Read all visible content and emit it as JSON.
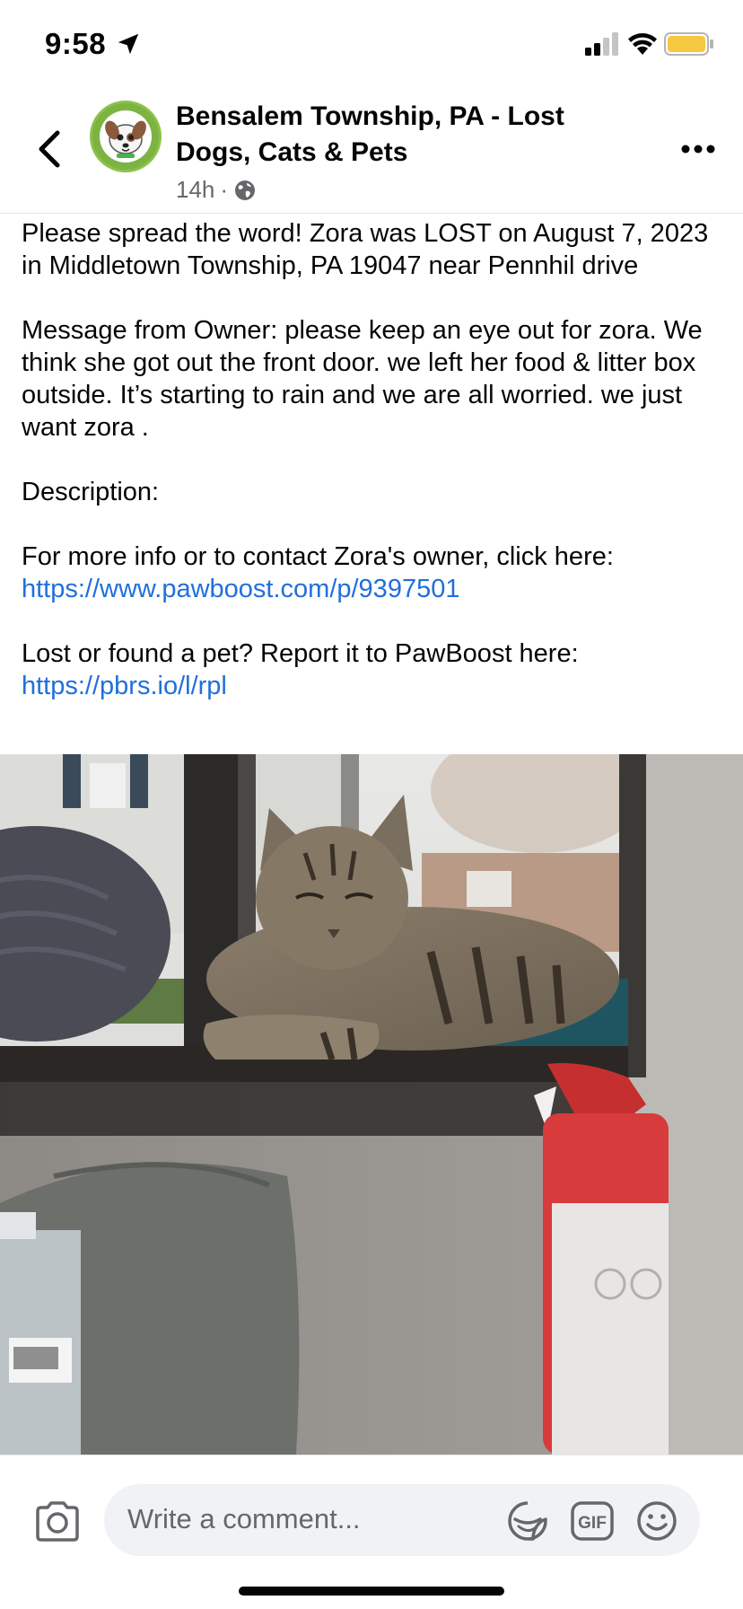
{
  "status_bar": {
    "time": "9:58",
    "battery_color": "#f5c842"
  },
  "header": {
    "group_name": "Bensalem Township, PA - Lost Dogs, Cats & Pets",
    "timestamp": "14h",
    "separator": "·",
    "privacy_icon": "globe-icon",
    "back_icon": "chevron-left-icon",
    "more_icon": "more-dots-icon"
  },
  "post": {
    "paragraph1": "Please spread the word! Zora was LOST on August 7, 2023 in Middletown Township, PA 19047 near Pennhil drive",
    "paragraph2": "Message from Owner: please keep an eye out for zora. We think she got out the front door. we left her food & litter box outside. It’s starting to rain and we are all worried. we just want zora .",
    "paragraph3": "Description:",
    "paragraph4_text": "For more info or to contact Zora's owner, click here:",
    "paragraph4_link": "https://www.pawboost.com/p/9397501",
    "paragraph5_text": "Lost or found a pet? Report it to PawBoost here:",
    "paragraph5_link": "https://pbrs.io/l/rpl",
    "link_color": "#216fdb"
  },
  "photo": {
    "subject": "tabby cat lying on window sill"
  },
  "comment_bar": {
    "placeholder": "Write a comment...",
    "camera_icon": "camera-icon",
    "sticker_icon": "sticker-icon",
    "gif_label": "GIF",
    "emoji_icon": "emoji-icon"
  }
}
